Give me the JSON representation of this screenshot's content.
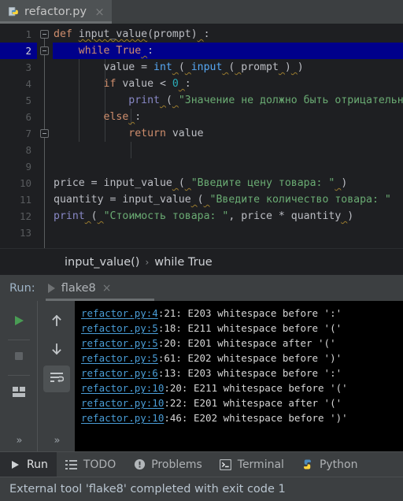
{
  "window": {
    "tab": {
      "filename": "refactor.py",
      "icon": "python-file-icon",
      "close_label": "×"
    }
  },
  "editor": {
    "line_numbers": [
      "1",
      "2",
      "3",
      "4",
      "5",
      "6",
      "7",
      "8",
      "9",
      "10",
      "11",
      "12",
      "13"
    ],
    "active_line": 2,
    "lines": [
      {
        "n": 1,
        "tokens": [
          {
            "t": "def",
            "c": "kw"
          },
          {
            "t": " ",
            "c": "punc"
          },
          {
            "t": "input_value",
            "c": "def-fn wavy"
          },
          {
            "t": "(",
            "c": "punc"
          },
          {
            "t": "prompt",
            "c": "id"
          },
          {
            "t": ")",
            "c": "punc"
          },
          {
            "t": " ",
            "c": "wavy"
          },
          {
            "t": ":",
            "c": "punc"
          }
        ],
        "text": "def input_value(prompt) :"
      },
      {
        "n": 2,
        "tokens": [
          {
            "t": "    ",
            "c": "punc"
          },
          {
            "t": "while",
            "c": "kw"
          },
          {
            "t": " ",
            "c": "punc"
          },
          {
            "t": "True",
            "c": "kw"
          },
          {
            "t": " ",
            "c": "wavy"
          },
          {
            "t": ":",
            "c": "punc"
          }
        ],
        "text": "    while True :"
      },
      {
        "n": 3,
        "tokens": [
          {
            "t": "        value = ",
            "c": "id"
          },
          {
            "t": "int",
            "c": "fn"
          },
          {
            "t": " ",
            "c": "wavy"
          },
          {
            "t": "(",
            "c": "punc"
          },
          {
            "t": " ",
            "c": "wavy"
          },
          {
            "t": "input",
            "c": "fn"
          },
          {
            "t": " ",
            "c": "wavy"
          },
          {
            "t": "(",
            "c": "punc"
          },
          {
            "t": " ",
            "c": "wavy"
          },
          {
            "t": "prompt",
            "c": "id"
          },
          {
            "t": " ",
            "c": "wavy"
          },
          {
            "t": ")",
            "c": "punc"
          },
          {
            "t": " ",
            "c": "wavy"
          },
          {
            "t": ")",
            "c": "punc"
          }
        ],
        "text": "        value = int ( input ( prompt ) )"
      },
      {
        "n": 4,
        "tokens": [
          {
            "t": "        ",
            "c": "punc"
          },
          {
            "t": "if",
            "c": "kw"
          },
          {
            "t": " value < ",
            "c": "id"
          },
          {
            "t": "0",
            "c": "num"
          },
          {
            "t": " ",
            "c": "wavy"
          },
          {
            "t": ":",
            "c": "punc"
          }
        ],
        "text": "        if value < 0 :"
      },
      {
        "n": 5,
        "tokens": [
          {
            "t": "            ",
            "c": "punc"
          },
          {
            "t": "print",
            "c": "bi"
          },
          {
            "t": " ",
            "c": "wavy"
          },
          {
            "t": "(",
            "c": "punc"
          },
          {
            "t": " ",
            "c": "wavy"
          },
          {
            "t": "\"Значение не должно быть отрицательным\"",
            "c": "str"
          }
        ],
        "text": "            print ( \"Значение не должно быть отрицательным\" )"
      },
      {
        "n": 6,
        "tokens": [
          {
            "t": "        ",
            "c": "punc"
          },
          {
            "t": "else",
            "c": "kw"
          },
          {
            "t": " ",
            "c": "wavy"
          },
          {
            "t": ":",
            "c": "punc"
          }
        ],
        "text": "        else :"
      },
      {
        "n": 7,
        "tokens": [
          {
            "t": "            ",
            "c": "punc"
          },
          {
            "t": "return",
            "c": "kw"
          },
          {
            "t": " value",
            "c": "id"
          }
        ],
        "text": "            return value"
      },
      {
        "n": 8,
        "tokens": [],
        "text": ""
      },
      {
        "n": 9,
        "tokens": [],
        "text": ""
      },
      {
        "n": 10,
        "tokens": [
          {
            "t": "price = ",
            "c": "id"
          },
          {
            "t": "input_value",
            "c": "id"
          },
          {
            "t": " ",
            "c": "wavy"
          },
          {
            "t": "(",
            "c": "punc"
          },
          {
            "t": " ",
            "c": "wavy"
          },
          {
            "t": "\"Введите цену товара: \"",
            "c": "str"
          },
          {
            "t": " ",
            "c": "wavy"
          },
          {
            "t": ")",
            "c": "punc"
          }
        ],
        "text": "price = input_value ( \"Введите цену товара: \" )"
      },
      {
        "n": 11,
        "tokens": [
          {
            "t": "quantity = ",
            "c": "id"
          },
          {
            "t": "input_value",
            "c": "id"
          },
          {
            "t": " ",
            "c": "wavy"
          },
          {
            "t": "(",
            "c": "punc"
          },
          {
            "t": " ",
            "c": "wavy"
          },
          {
            "t": "\"Введите количество товара: \"",
            "c": "str"
          }
        ],
        "text": "quantity = input_value ( \"Введите количество товара: \" )"
      },
      {
        "n": 12,
        "tokens": [
          {
            "t": "print",
            "c": "bi"
          },
          {
            "t": " ",
            "c": "wavy"
          },
          {
            "t": "(",
            "c": "punc"
          },
          {
            "t": " ",
            "c": "wavy"
          },
          {
            "t": "\"Стоимость товара: \"",
            "c": "str"
          },
          {
            "t": ", price * quantity",
            "c": "id"
          },
          {
            "t": " ",
            "c": "wavy"
          },
          {
            "t": ")",
            "c": "punc"
          }
        ],
        "text": "print ( \"Стоимость товара: \", price * quantity )"
      },
      {
        "n": 13,
        "tokens": [],
        "text": ""
      }
    ]
  },
  "breadcrumb": {
    "items": [
      "input_value()",
      "while True"
    ],
    "separator": "›"
  },
  "run_panel": {
    "label": "Run:",
    "tab": {
      "name": "flake8",
      "close_label": "×",
      "run_icon": "play-triangle-icon"
    },
    "toolbar_left": [
      {
        "name": "rerun-button",
        "icon": "play-green-icon"
      },
      {
        "name": "stop-button",
        "icon": "stop-square-icon"
      },
      {
        "name": "layout-button",
        "icon": "layout-icon"
      },
      {
        "name": "more-left-button",
        "icon": "chevrons-right-icon",
        "label": "»"
      }
    ],
    "toolbar_right": [
      {
        "name": "up-button",
        "icon": "arrow-up-icon"
      },
      {
        "name": "down-button",
        "icon": "arrow-down-icon"
      },
      {
        "name": "soft-wrap-button",
        "icon": "soft-wrap-icon",
        "selected": true
      },
      {
        "name": "more-right-button",
        "icon": "chevrons-right-icon",
        "label": "»"
      }
    ],
    "output": [
      {
        "link": "refactor.py:4",
        "rest": ":21: E203 whitespace before ':'"
      },
      {
        "link": "refactor.py:5",
        "rest": ":18: E211 whitespace before '('"
      },
      {
        "link": "refactor.py:5",
        "rest": ":20: E201 whitespace after '('"
      },
      {
        "link": "refactor.py:5",
        "rest": ":61: E202 whitespace before ')'"
      },
      {
        "link": "refactor.py:6",
        "rest": ":13: E203 whitespace before ':'"
      },
      {
        "link": "refactor.py:10",
        "rest": ":20: E211 whitespace before '('"
      },
      {
        "link": "refactor.py:10",
        "rest": ":22: E201 whitespace after '('"
      },
      {
        "link": "refactor.py:10",
        "rest": ":46: E202 whitespace before ')'"
      }
    ]
  },
  "bottom_bar": {
    "items": [
      {
        "label": "Run",
        "icon": "play-triangle-icon",
        "active": true
      },
      {
        "label": "TODO",
        "icon": "todo-list-icon",
        "active": false
      },
      {
        "label": "Problems",
        "icon": "problems-warning-icon",
        "active": false
      },
      {
        "label": "Terminal",
        "icon": "terminal-icon",
        "active": false
      },
      {
        "label": "Python",
        "icon": "python-console-icon",
        "active": false
      }
    ]
  },
  "status_bar": {
    "message": "External tool 'flake8' completed with exit code 1"
  },
  "colors": {
    "editor_bg": "#1e1f22",
    "panel_bg": "#3c3f41",
    "console_bg": "#000000",
    "caret_row": "#00008b",
    "keyword": "#cf8e6d",
    "string": "#6aab73",
    "number": "#2aacb8",
    "function": "#56a8f5",
    "builtin": "#8888c6",
    "link": "#499cd5",
    "status_text": "#b8c4cf",
    "run_green": "#499c54"
  }
}
